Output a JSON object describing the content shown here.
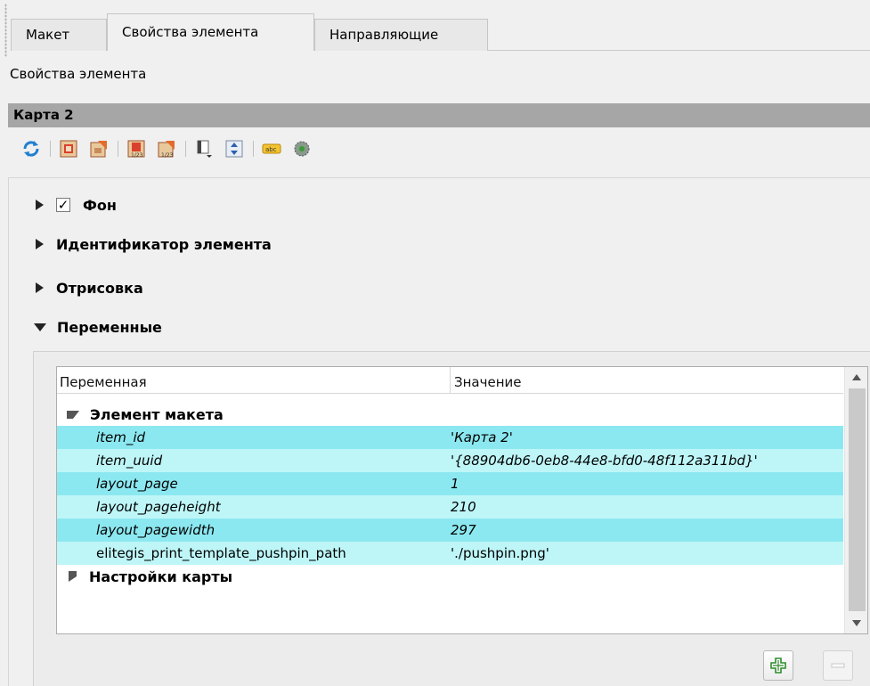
{
  "tabs": [
    {
      "label": "Макет"
    },
    {
      "label": "Свойства элемента"
    },
    {
      "label": "Направляющие"
    }
  ],
  "section_label": "Свойства элемента",
  "item_title": "Карта 2",
  "toolbar_icons": [
    "refresh-icon",
    "raise-item-icon",
    "lower-item-icon",
    "move-page-1-icon",
    "move-page-2-icon",
    "align-icon",
    "distribute-icon",
    "label-abc-icon",
    "settings-gear-icon"
  ],
  "groups": {
    "background": {
      "label": "Фон",
      "checked": true
    },
    "item_id": {
      "label": "Идентификатор элемента"
    },
    "rendering": {
      "label": "Отрисовка"
    },
    "variables": {
      "label": "Переменные"
    }
  },
  "variables_table": {
    "headers": {
      "name": "Переменная",
      "value": "Значение"
    },
    "group_layout_item": "Элемент макета",
    "rows": [
      {
        "name": "item_id",
        "value": "'Карта 2'"
      },
      {
        "name": "item_uuid",
        "value": "'{88904db6-0eb8-44e8-bfd0-48f112a311bd}'"
      },
      {
        "name": "layout_page",
        "value": "1"
      },
      {
        "name": "layout_pageheight",
        "value": "210"
      },
      {
        "name": "layout_pagewidth",
        "value": "297"
      },
      {
        "name": "elitegis_print_template_pushpin_path",
        "value": "'./pushpin.png'"
      }
    ],
    "group_map_settings": "Настройки карты"
  },
  "colors": {
    "readonly_row": "#8ce8f0",
    "editable_row": "#bef6f8",
    "title_bar": "#a6a6a6"
  }
}
